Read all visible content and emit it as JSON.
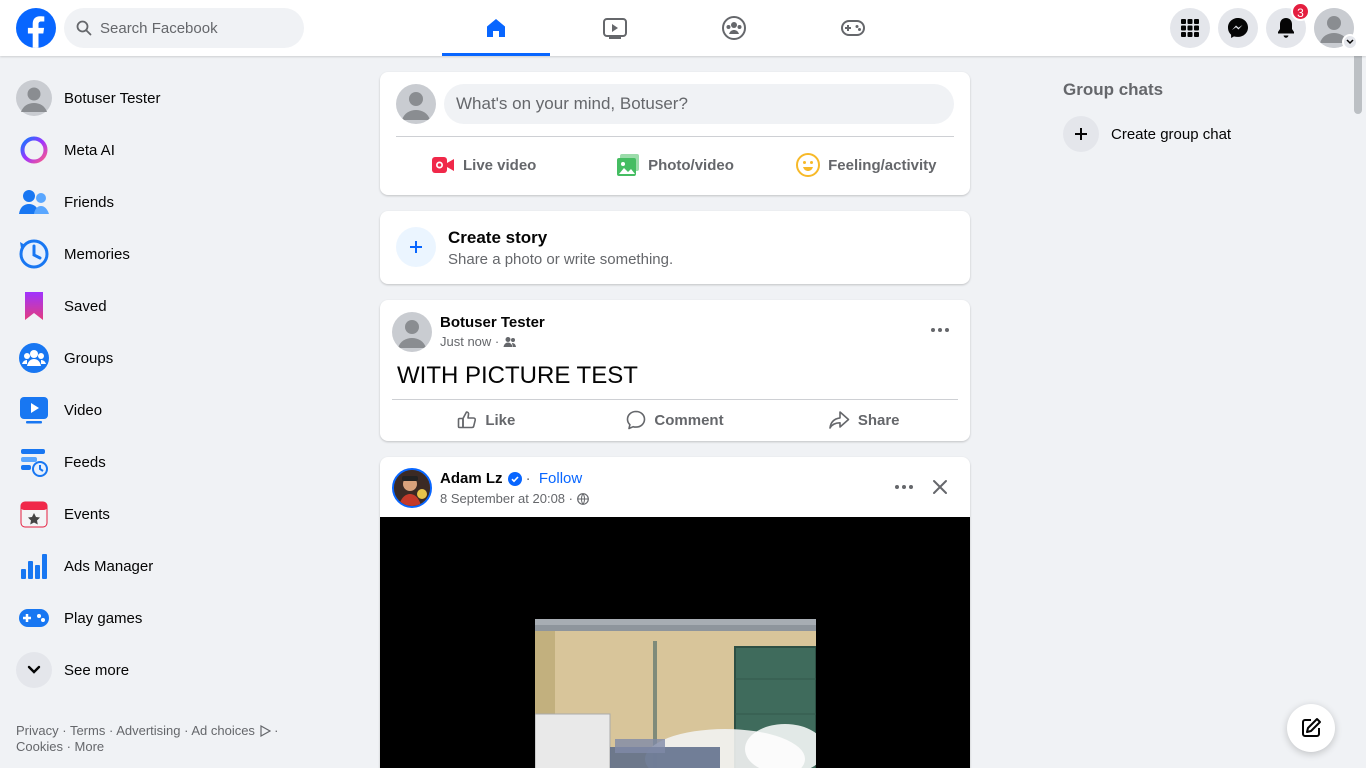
{
  "colors": {
    "brand": "#0866ff",
    "badge": "#e41e3f",
    "text_secondary": "#65676b"
  },
  "topbar": {
    "search_placeholder": "Search Facebook",
    "notifications_count": "3",
    "tabs": [
      {
        "icon": "home-icon",
        "active": true
      },
      {
        "icon": "video-icon",
        "active": false
      },
      {
        "icon": "groups-icon",
        "active": false
      },
      {
        "icon": "gaming-icon",
        "active": false
      }
    ]
  },
  "sidebar": {
    "items": [
      {
        "label": "Botuser Tester",
        "icon": "profile-avatar"
      },
      {
        "label": "Meta AI",
        "icon": "meta-ai-icon"
      },
      {
        "label": "Friends",
        "icon": "friends-icon"
      },
      {
        "label": "Memories",
        "icon": "memories-icon"
      },
      {
        "label": "Saved",
        "icon": "saved-icon"
      },
      {
        "label": "Groups",
        "icon": "groups-icon"
      },
      {
        "label": "Video",
        "icon": "video-icon"
      },
      {
        "label": "Feeds",
        "icon": "feeds-icon"
      },
      {
        "label": "Events",
        "icon": "events-icon"
      },
      {
        "label": "Ads Manager",
        "icon": "ads-manager-icon"
      },
      {
        "label": "Play games",
        "icon": "games-icon"
      },
      {
        "label": "See more",
        "icon": "chevron-down-icon"
      }
    ],
    "footer": {
      "privacy": "Privacy",
      "terms": "Terms",
      "advertising": "Advertising",
      "ad_choices": "Ad choices",
      "cookies": "Cookies",
      "more": "More",
      "sep": " · "
    }
  },
  "composer": {
    "placeholder": "What's on your mind, Botuser?",
    "live_video": "Live video",
    "photo_video": "Photo/video",
    "feeling": "Feeling/activity"
  },
  "story": {
    "title": "Create story",
    "subtitle": "Share a photo or write something."
  },
  "posts": [
    {
      "author": "Botuser Tester",
      "time": "Just now · ",
      "text": "WITH PICTURE TEST",
      "like": "Like",
      "comment": "Comment",
      "share": "Share"
    },
    {
      "author": "Adam Lz",
      "follow_sep": " · ",
      "follow": "Follow",
      "time": "8 September at 20:08 · "
    }
  ],
  "right": {
    "group_chats_title": "Group chats",
    "create_group_chat": "Create group chat"
  }
}
